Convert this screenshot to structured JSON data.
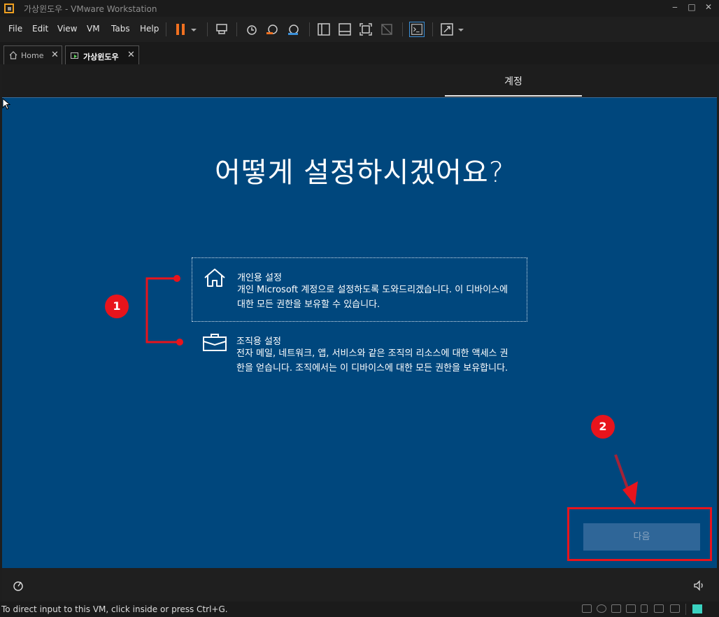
{
  "window": {
    "title": "가상윈도우 - VMware Workstation",
    "controls": [
      "‒",
      "□",
      "✕"
    ]
  },
  "menu": {
    "items": [
      "File",
      "Edit",
      "View",
      "VM",
      "Tabs",
      "Help"
    ]
  },
  "tabs": [
    {
      "label": "Home",
      "close": "✕"
    },
    {
      "label": "가상윈도우",
      "close": "✕"
    }
  ],
  "oobe": {
    "step": "계정",
    "heading": "어떻게 설정하시겠어요?",
    "options": [
      {
        "title": "개인용 설정",
        "desc": "개인 Microsoft 계정으로 설정하도록 도와드리겠습니다. 이 디바이스에 대한 모든 권한을 보유할 수 있습니다.",
        "icon": "home-icon"
      },
      {
        "title": "조직용 설정",
        "desc": "전자 메일, 네트워크, 앱, 서비스와 같은 조직의 리소스에 대한 액세스 권한을 얻습니다. 조직에서는 이 디바이스에 대한 모든 권한을 보유합니다.",
        "icon": "briefcase-icon"
      }
    ],
    "next": "다음"
  },
  "annotations": {
    "badge1": "1",
    "badge2": "2",
    "color": "#e8141c"
  },
  "status": {
    "text": "To direct input to this VM, click inside or press Ctrl+G."
  },
  "colors": {
    "vm_background": "#00477d",
    "accent_orange": "#f07020",
    "annotation_red": "#e8141c"
  }
}
